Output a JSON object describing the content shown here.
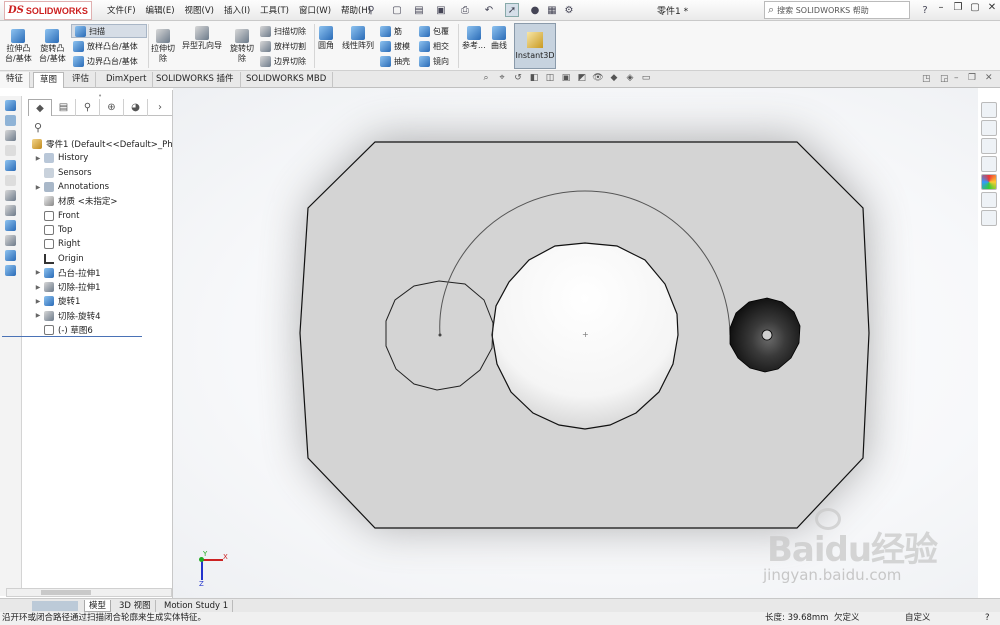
{
  "app": {
    "logo_ds": "DS",
    "logo_name": "SOLIDWORKS",
    "document_title": "零件1 *",
    "help_search_placeholder": "搜索 SOLIDWORKS 帮助"
  },
  "menus": [
    "文件(F)",
    "编辑(E)",
    "视图(V)",
    "插入(I)",
    "工具(T)",
    "窗口(W)",
    "帮助(H)"
  ],
  "ribbon": {
    "extrude_boss": [
      "拉伸凸",
      "台/基体"
    ],
    "revolve_boss": [
      "旋转凸",
      "台/基体"
    ],
    "sweep": "扫描",
    "loft_boss": "放样凸台/基体",
    "boundary_boss": "边界凸台/基体",
    "extrude_cut": [
      "拉伸切",
      "除"
    ],
    "hole_wizard": "异型孔向导",
    "revolve_cut": [
      "旋转切",
      "除"
    ],
    "swept_cut": "扫描切除",
    "lofted_cut": "放样切割",
    "boundary_cut": "边界切除",
    "fillet": "圆角",
    "linear_pattern": "线性阵列",
    "rib": "筋",
    "draft": "拔模",
    "shell": "抽壳",
    "wrap": "包覆",
    "intersect": "相交",
    "mirror": "镜向",
    "ref_geometry": "参考...",
    "curves": "曲线",
    "instant3d": "Instant3D"
  },
  "tabs": [
    "特征",
    "草图",
    "评估",
    "DimXpert",
    "SOLIDWORKS 插件",
    "SOLIDWORKS MBD"
  ],
  "feature_tree": {
    "root": "零件1  (Default<<Default>_Ph",
    "items": [
      {
        "label": "History",
        "expandable": true
      },
      {
        "label": "Sensors",
        "expandable": false
      },
      {
        "label": "Annotations",
        "expandable": true
      },
      {
        "label": "材质 <未指定>",
        "expandable": false
      },
      {
        "label": "Front",
        "expandable": false
      },
      {
        "label": "Top",
        "expandable": false
      },
      {
        "label": "Right",
        "expandable": false
      },
      {
        "label": "Origin",
        "expandable": false
      },
      {
        "label": "凸台-拉伸1",
        "expandable": true
      },
      {
        "label": "切除-拉伸1",
        "expandable": true
      },
      {
        "label": "旋转1",
        "expandable": true
      },
      {
        "label": "切除-旋转4",
        "expandable": true
      },
      {
        "label": "(-) 草图6",
        "expandable": false
      }
    ]
  },
  "triad": {
    "x_label": "X",
    "y_label": "Y",
    "z_label": "Z"
  },
  "bottom_tabs": [
    "模型",
    "3D 视图",
    "Motion Study 1"
  ],
  "status": {
    "message": "沿开环或闭合路径通过扫描闭合轮廓来生成实体特征。",
    "length": "长度: 39.68mm",
    "defined": "欠定义",
    "units": "自定义"
  },
  "watermark": {
    "text": "Baidu经验",
    "sub": "jingyan.baidu.com"
  },
  "colors": {
    "accent": "#c8d4e0",
    "part_face": "#d4d4d4",
    "logo_red": "#cc1f1f"
  }
}
